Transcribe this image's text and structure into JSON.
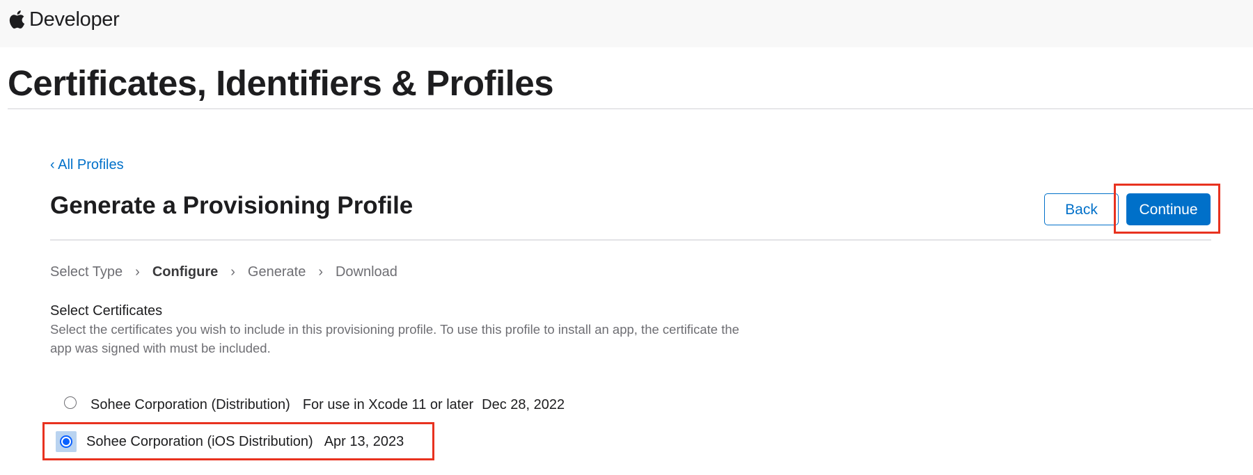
{
  "nav": {
    "brand_label": "Developer",
    "logo_icon": "apple-logo-icon"
  },
  "page": {
    "title": "Certificates, Identifiers & Profiles"
  },
  "breadcrumb": {
    "back_label": "‹ All Profiles"
  },
  "section": {
    "title": "Generate a Provisioning Profile",
    "back_button": "Back",
    "continue_button": "Continue"
  },
  "steps": [
    {
      "label": "Select Type",
      "active": false
    },
    {
      "label": "Configure",
      "active": true
    },
    {
      "label": "Generate",
      "active": false
    },
    {
      "label": "Download",
      "active": false
    }
  ],
  "step_separator": "›",
  "certificates": {
    "heading": "Select Certificates",
    "description": "Select the certificates you wish to include in this provisioning profile. To use this profile to install an app, the certificate the app was signed with must be included.",
    "items": [
      {
        "name": "Sohee Corporation (Distribution)",
        "note": "For use in Xcode 11 or later",
        "date": "Dec 28, 2022",
        "selected": false
      },
      {
        "name": "Sohee Corporation (iOS Distribution)",
        "note": "",
        "date": "Apr 13, 2023",
        "selected": true
      }
    ]
  },
  "colors": {
    "accent": "#0070c9",
    "highlight": "#e8321f",
    "nav_background": "#f8f8f8"
  }
}
